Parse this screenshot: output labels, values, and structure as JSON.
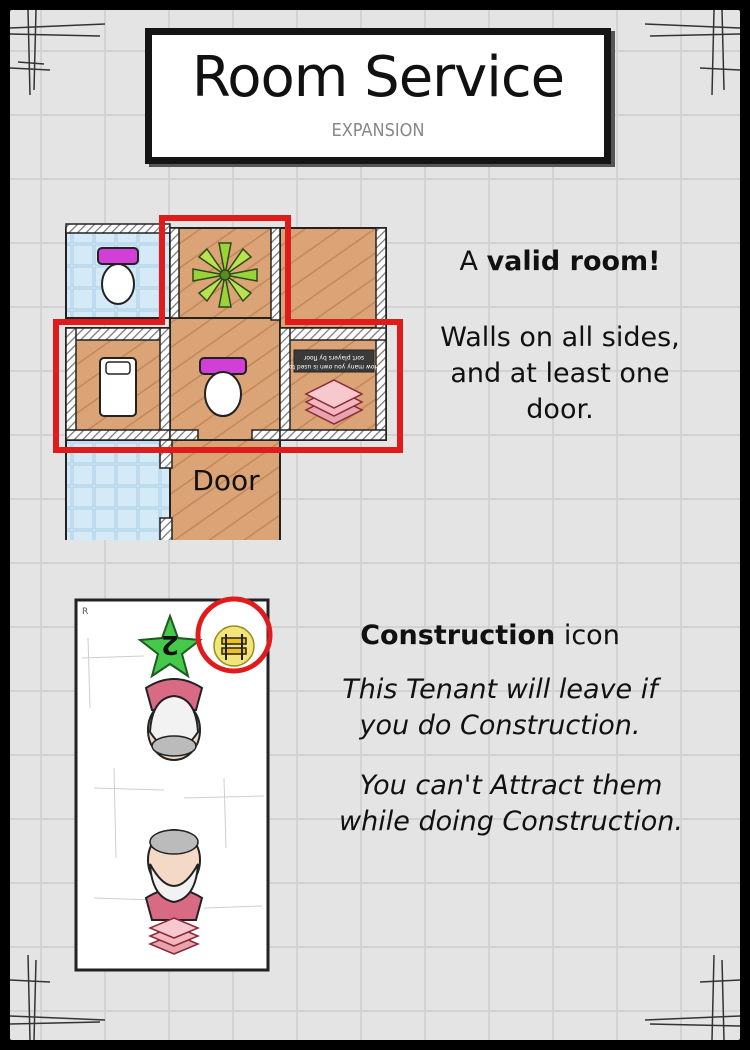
{
  "header": {
    "title": "Room Service",
    "subtitle": "EXPANSION"
  },
  "room_example": {
    "prefix": "A",
    "highlight": "valid room!",
    "rule_line1": "Walls on all sides,",
    "rule_line2": "and at least one",
    "rule_line3": "door.",
    "door_label": "Door",
    "tile_text_line1": "How many you own is used to",
    "tile_text_line2": "sort players by floor"
  },
  "construction": {
    "title_bold": "Construction",
    "title_rest": "icon",
    "line1": "This Tenant will leave if",
    "line2": "you do Construction.",
    "line3": "You can't Attract them",
    "line4": "while doing Construction.",
    "card_corner": "R",
    "star_value": "2"
  },
  "colors": {
    "highlight_red": "#e01b1b",
    "wood": "#d9a277",
    "tile_blue": "#cfe7f5",
    "toilet_purple": "#d23fd6",
    "star_green": "#44c94a",
    "icon_yellow": "#f2e476"
  }
}
